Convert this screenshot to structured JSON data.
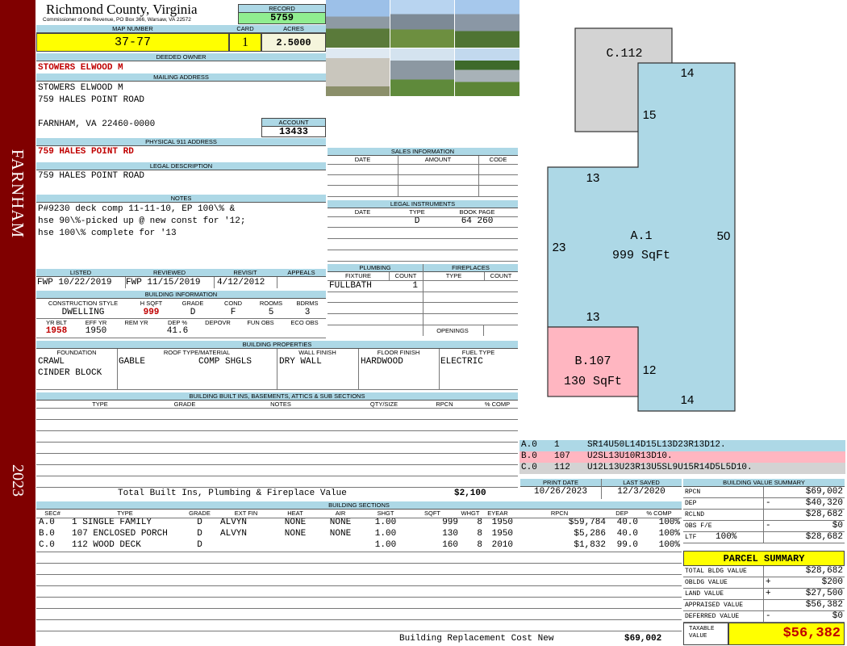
{
  "sidebar": {
    "town": "FARNHAM",
    "year": "2023"
  },
  "header": {
    "county": "Richmond County, Virginia",
    "address": "Commissioner of the Revenue, PO Box 366, Warsaw, VA 22572",
    "record_label": "RECORD",
    "record": "5759"
  },
  "map": {
    "map_label": "MAP NUMBER",
    "map_number": "37-77",
    "card_label": "CARD",
    "card": "1",
    "acres_label": "ACRES",
    "acres": "2.5000"
  },
  "owner": {
    "deeded_label": "DEEDED OWNER",
    "deeded_owner": "STOWERS ELWOOD M",
    "mailing_label": "MAILING ADDRESS",
    "mail_name": "STOWERS ELWOOD M",
    "mail_street": "759 HALES POINT ROAD",
    "mail_city": "FARNHAM, VA 22460-0000",
    "account_label": "ACCOUNT",
    "account": "13433"
  },
  "physical": {
    "label": "PHYSICAL 911 ADDRESS",
    "address": "759 HALES POINT RD"
  },
  "legal": {
    "label": "LEGAL DESCRIPTION",
    "text": "759 HALES POINT ROAD"
  },
  "notes": {
    "label": "NOTES",
    "line1": "P#9230 deck comp 11-11-10, EP 100\\% &",
    "line2": "hse 90\\%-picked up @ new const for '12;",
    "line3": "hse 100\\% complete for '13"
  },
  "dates": {
    "listed_label": "LISTED",
    "listed": "FWP  10/22/2019",
    "reviewed_label": "REVIEWED",
    "reviewed": "FWP  11/15/2019",
    "revisit_label": "REVISIT",
    "revisit": "4/12/2012",
    "appeals_label": "APPEALS",
    "appeals": ""
  },
  "building_info": {
    "label": "BUILDING INFORMATION",
    "h_construction": "CONSTRUCTION STYLE",
    "h_hsqft": "H SQFT",
    "h_grade": "GRADE",
    "h_cond": "COND",
    "h_rooms": "ROOMS",
    "h_bdrms": "BDRMS",
    "construction": "DWELLING",
    "hsqft": "999",
    "grade": "D",
    "cond": "F",
    "rooms": "5",
    "bdrms": "3",
    "h_yrblt": "YR BLT",
    "h_effyr": "EFF YR",
    "h_remyr": "REM YR",
    "h_dep": "DEP %",
    "h_depovr": "DEPOVR",
    "h_funobs": "FUN OBS",
    "h_ecoobs": "ECO OBS",
    "yrblt": "1958",
    "effyr": "1950",
    "remyr": "",
    "dep": "41.6",
    "depovr": "",
    "funobs": "",
    "ecoobs": ""
  },
  "sales": {
    "label": "SALES INFORMATION",
    "h_date": "DATE",
    "h_amount": "AMOUNT",
    "h_code": "CODE"
  },
  "instruments": {
    "label": "LEGAL INSTRUMENTS",
    "h_date": "DATE",
    "h_type": "TYPE",
    "h_book": "BOOK PAGE",
    "type": "D",
    "book": "64 260"
  },
  "plumbing": {
    "label": "PLUMBING",
    "h_fixture": "FIXTURE",
    "h_count": "COUNT",
    "fixture": "FULLBATH",
    "count": "1"
  },
  "fireplaces": {
    "label": "FIREPLACES",
    "h_type": "TYPE",
    "h_count": "COUNT",
    "openings_label": "OPENINGS"
  },
  "properties": {
    "label": "BUILDING PROPERTIES",
    "h_foundation": "FOUNDATION",
    "h_roof": "ROOF TYPE/MATERIAL",
    "h_wall": "WALL FINISH",
    "h_floor": "FLOOR FINISH",
    "h_fuel": "FUEL TYPE",
    "foundation1": "CRAWL",
    "foundation2": "CINDER BLOCK",
    "roof_type": "GABLE",
    "roof_material": "COMP SHGLS",
    "wall": "DRY WALL",
    "floor": "HARDWOOD",
    "fuel": "ELECTRIC"
  },
  "builtins": {
    "label": "BUILDING BUILT INS, BASEMENTS, ATTICS & SUB SECTIONS",
    "h_type": "TYPE",
    "h_grade": "GRADE",
    "h_notes": "NOTES",
    "h_qty": "QTY/SIZE",
    "h_rpcn": "RPCN",
    "h_comp": "% COMP",
    "total_label": "Total Built Ins, Plumbing & Fireplace Value",
    "total": "$2,100"
  },
  "print": {
    "print_label": "PRINT DATE",
    "print_date": "10/26/2023",
    "saved_label": "LAST SAVED",
    "saved_date": "12/3/2020"
  },
  "sketch_legend": [
    {
      "sec": "A.0",
      "num": "1",
      "code": "SR14U50L14D15L13D23R13D12."
    },
    {
      "sec": "B.0",
      "num": "107",
      "code": "U2SL13U10R13D10."
    },
    {
      "sec": "C.0",
      "num": "112",
      "code": "U12L13U23R13U5SL9U15R14D5L5D10."
    }
  ],
  "sketch": {
    "c_label": "C.112",
    "a_label": "A.1",
    "a_area": "999 SqFt",
    "b_label": "B.107",
    "b_area": "130 SqFt",
    "dims": {
      "d14_top": "14",
      "d15": "15",
      "d13_top": "13",
      "d23": "23",
      "d50": "50",
      "d13_mid": "13",
      "d12": "12",
      "d14_bot": "14"
    },
    "colors": {
      "a": "#add8e6",
      "b": "#ffb6c1",
      "c": "#d3d3d3"
    }
  },
  "sections": {
    "label": "BUILDING SECTIONS",
    "headers": [
      "SEC#",
      "TYPE",
      "GRADE",
      "EXT FIN",
      "HEAT",
      "AIR",
      "SHGT",
      "SQFT",
      "WHGT",
      "EYEAR",
      "RPCN",
      "DEP",
      "% COMP"
    ],
    "rows": [
      [
        "A.0",
        "1 SINGLE FAMILY",
        "D",
        "ALVYN",
        "NONE",
        "NONE",
        "1.00",
        "999",
        "8",
        "1950",
        "$59,784",
        "40.0",
        "100%"
      ],
      [
        "B.0",
        "107 ENCLOSED PORCH",
        "D",
        "ALVYN",
        "NONE",
        "NONE",
        "1.00",
        "130",
        "8",
        "1950",
        "$5,286",
        "40.0",
        "100%"
      ],
      [
        "C.0",
        "112 WOOD DECK",
        "D",
        "",
        "",
        "",
        "1.00",
        "160",
        "8",
        "2010",
        "$1,832",
        "99.0",
        "100%"
      ]
    ],
    "replacement_label": "Building Replacement Cost New",
    "replacement": "$69,002"
  },
  "value_summary": {
    "label": "BUILDING VALUE SUMMARY",
    "rows": [
      {
        "k": "RPCN",
        "sign": "",
        "v": "$69,002"
      },
      {
        "k": "DEP",
        "sign": "-",
        "v": "$40,320"
      },
      {
        "k": "RCLND",
        "sign": "",
        "v": "$28,682"
      },
      {
        "k": "OBS F/E",
        "sign": "-",
        "v": "$0"
      },
      {
        "k": "LTF",
        "sign": "100%",
        "v": "$28,682"
      }
    ]
  },
  "parcel": {
    "label": "PARCEL SUMMARY",
    "rows": [
      {
        "k": "TOTAL BLDG VALUE",
        "sign": "",
        "v": "$28,682"
      },
      {
        "k": "OBLDG VALUE",
        "sign": "+",
        "v": "$200"
      },
      {
        "k": "LAND VALUE",
        "sign": "+",
        "v": "$27,500"
      },
      {
        "k": "APPRAISED VALUE",
        "sign": "",
        "v": "$56,382"
      },
      {
        "k": "DEFERRED VALUE",
        "sign": "-",
        "v": "$0"
      }
    ],
    "taxable_label1": "TAXABLE",
    "taxable_label2": "VALUE",
    "taxable": "$56,382"
  }
}
